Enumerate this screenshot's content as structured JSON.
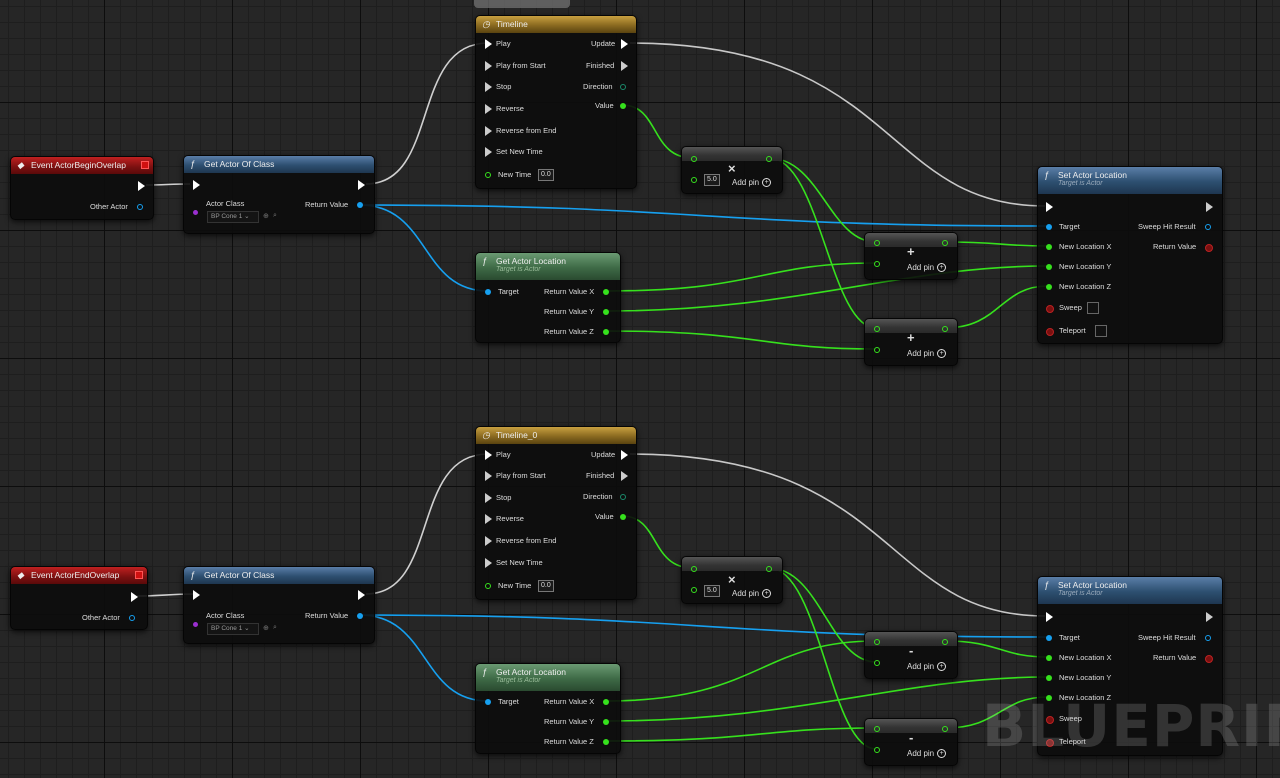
{
  "graph": {
    "watermark": "BLUEPRINT",
    "colors": {
      "exec_wire": "#e0e0e0",
      "float_wire": "#36e11d",
      "object_wire": "#16a0f0",
      "event_header": "#8a1010",
      "function_header": "#2d4f70",
      "pure_function_header": "#3e6a46",
      "timeline_header": "#8a6a20"
    }
  },
  "events": {
    "begin": {
      "title": "Event ActorBeginOverlap",
      "other_actor": "Other Actor"
    },
    "end": {
      "title": "Event ActorEndOverlap",
      "other_actor": "Other Actor"
    }
  },
  "get_actor_of_class": {
    "title": "Get Actor Of Class",
    "actor_class_label": "Actor Class",
    "actor_class_value": "BP Cone 1",
    "return_value": "Return Value"
  },
  "timelines": [
    {
      "title": "Timeline",
      "pins": [
        "Play",
        "Play from Start",
        "Stop",
        "Reverse",
        "Reverse from End",
        "Set New Time",
        "New Time"
      ],
      "outputs": [
        "Update",
        "Finished",
        "Direction",
        "Value"
      ],
      "new_time": "0.0"
    },
    {
      "title": "Timeline_0",
      "pins": [
        "Play",
        "Play from Start",
        "Stop",
        "Reverse",
        "Reverse from End",
        "Set New Time",
        "New Time"
      ],
      "outputs": [
        "Update",
        "Finished",
        "Direction",
        "Value"
      ],
      "new_time": "0.0"
    }
  ],
  "get_actor_location": {
    "title": "Get Actor Location",
    "subtitle": "Target is Actor",
    "target": "Target",
    "outputs": [
      "Return Value X",
      "Return Value Y",
      "Return Value Z"
    ]
  },
  "math": {
    "multiply_symbol": "×",
    "multiply_value": "5.0",
    "add_symbol": "+",
    "subtract_symbol": "-",
    "add_pin": "Add pin"
  },
  "set_actor_location": {
    "title": "Set Actor Location",
    "subtitle": "Target is Actor",
    "inputs": [
      "Target",
      "New Location X",
      "New Location Y",
      "New Location Z",
      "Sweep",
      "Teleport"
    ],
    "outputs": [
      "Sweep Hit Result",
      "Return Value"
    ]
  }
}
